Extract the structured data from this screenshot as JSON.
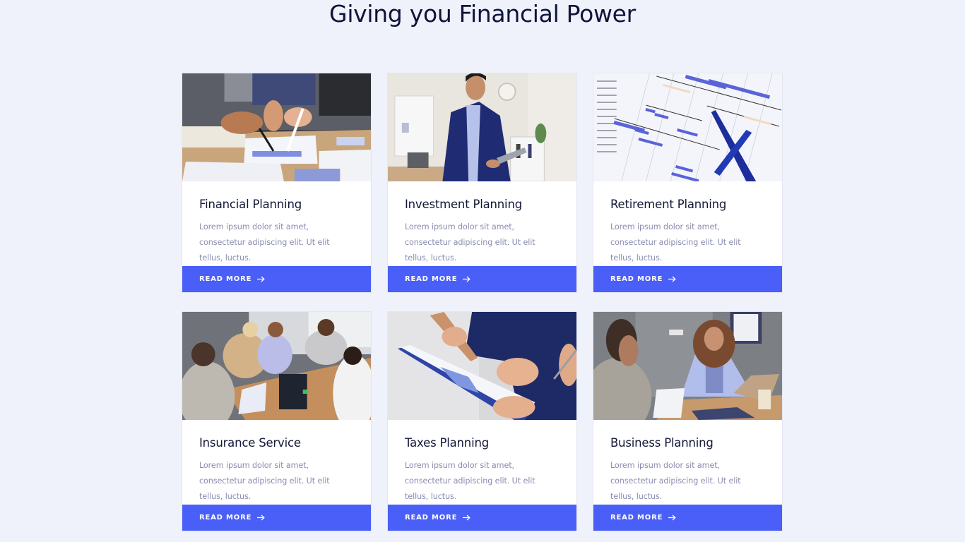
{
  "page": {
    "title": "Giving you Financial Power"
  },
  "colors": {
    "background": "#eff2fa",
    "accent": "#4a5ff7",
    "title_text": "#10133a",
    "body_text": "#8a8cb0"
  },
  "cards": [
    {
      "title": "Financial Planning",
      "description": "Lorem ipsum dolor sit amet, consectetur adipiscing elit. Ut elit tellus, luctus.",
      "button_label": "READ MORE",
      "button_icon": "arrow-right-icon",
      "image_alt": "Hands pointing at financial charts on a desk"
    },
    {
      "title": "Investment Planning",
      "description": "Lorem ipsum dolor sit amet, consectetur adipiscing elit. Ut elit tellus, luctus.",
      "button_label": "READ MORE",
      "button_icon": "arrow-right-icon",
      "image_alt": "Businessman in navy suit holding a tablet in an office"
    },
    {
      "title": "Retirement Planning",
      "description": "Lorem ipsum dolor sit amet, consectetur adipiscing elit. Ut elit tellus, luctus.",
      "button_label": "READ MORE",
      "button_icon": "arrow-right-icon",
      "image_alt": "Gantt chart printout with a blue pen"
    },
    {
      "title": "Insurance Service",
      "description": "Lorem ipsum dolor sit amet, consectetur adipiscing elit. Ut elit tellus, luctus.",
      "button_label": "READ MORE",
      "button_icon": "arrow-right-icon",
      "image_alt": "Team meeting around a wooden table with laptops"
    },
    {
      "title": "Taxes Planning",
      "description": "Lorem ipsum dolor sit amet, consectetur adipiscing elit. Ut elit tellus, luctus.",
      "button_label": "READ MORE",
      "button_icon": "arrow-right-icon",
      "image_alt": "Hands reviewing a chart on a clipboard"
    },
    {
      "title": "Business Planning",
      "description": "Lorem ipsum dolor sit amet, consectetur adipiscing elit. Ut elit tellus, luctus.",
      "button_label": "READ MORE",
      "button_icon": "arrow-right-icon",
      "image_alt": "Woman in lavender blazer in a business consultation"
    }
  ]
}
